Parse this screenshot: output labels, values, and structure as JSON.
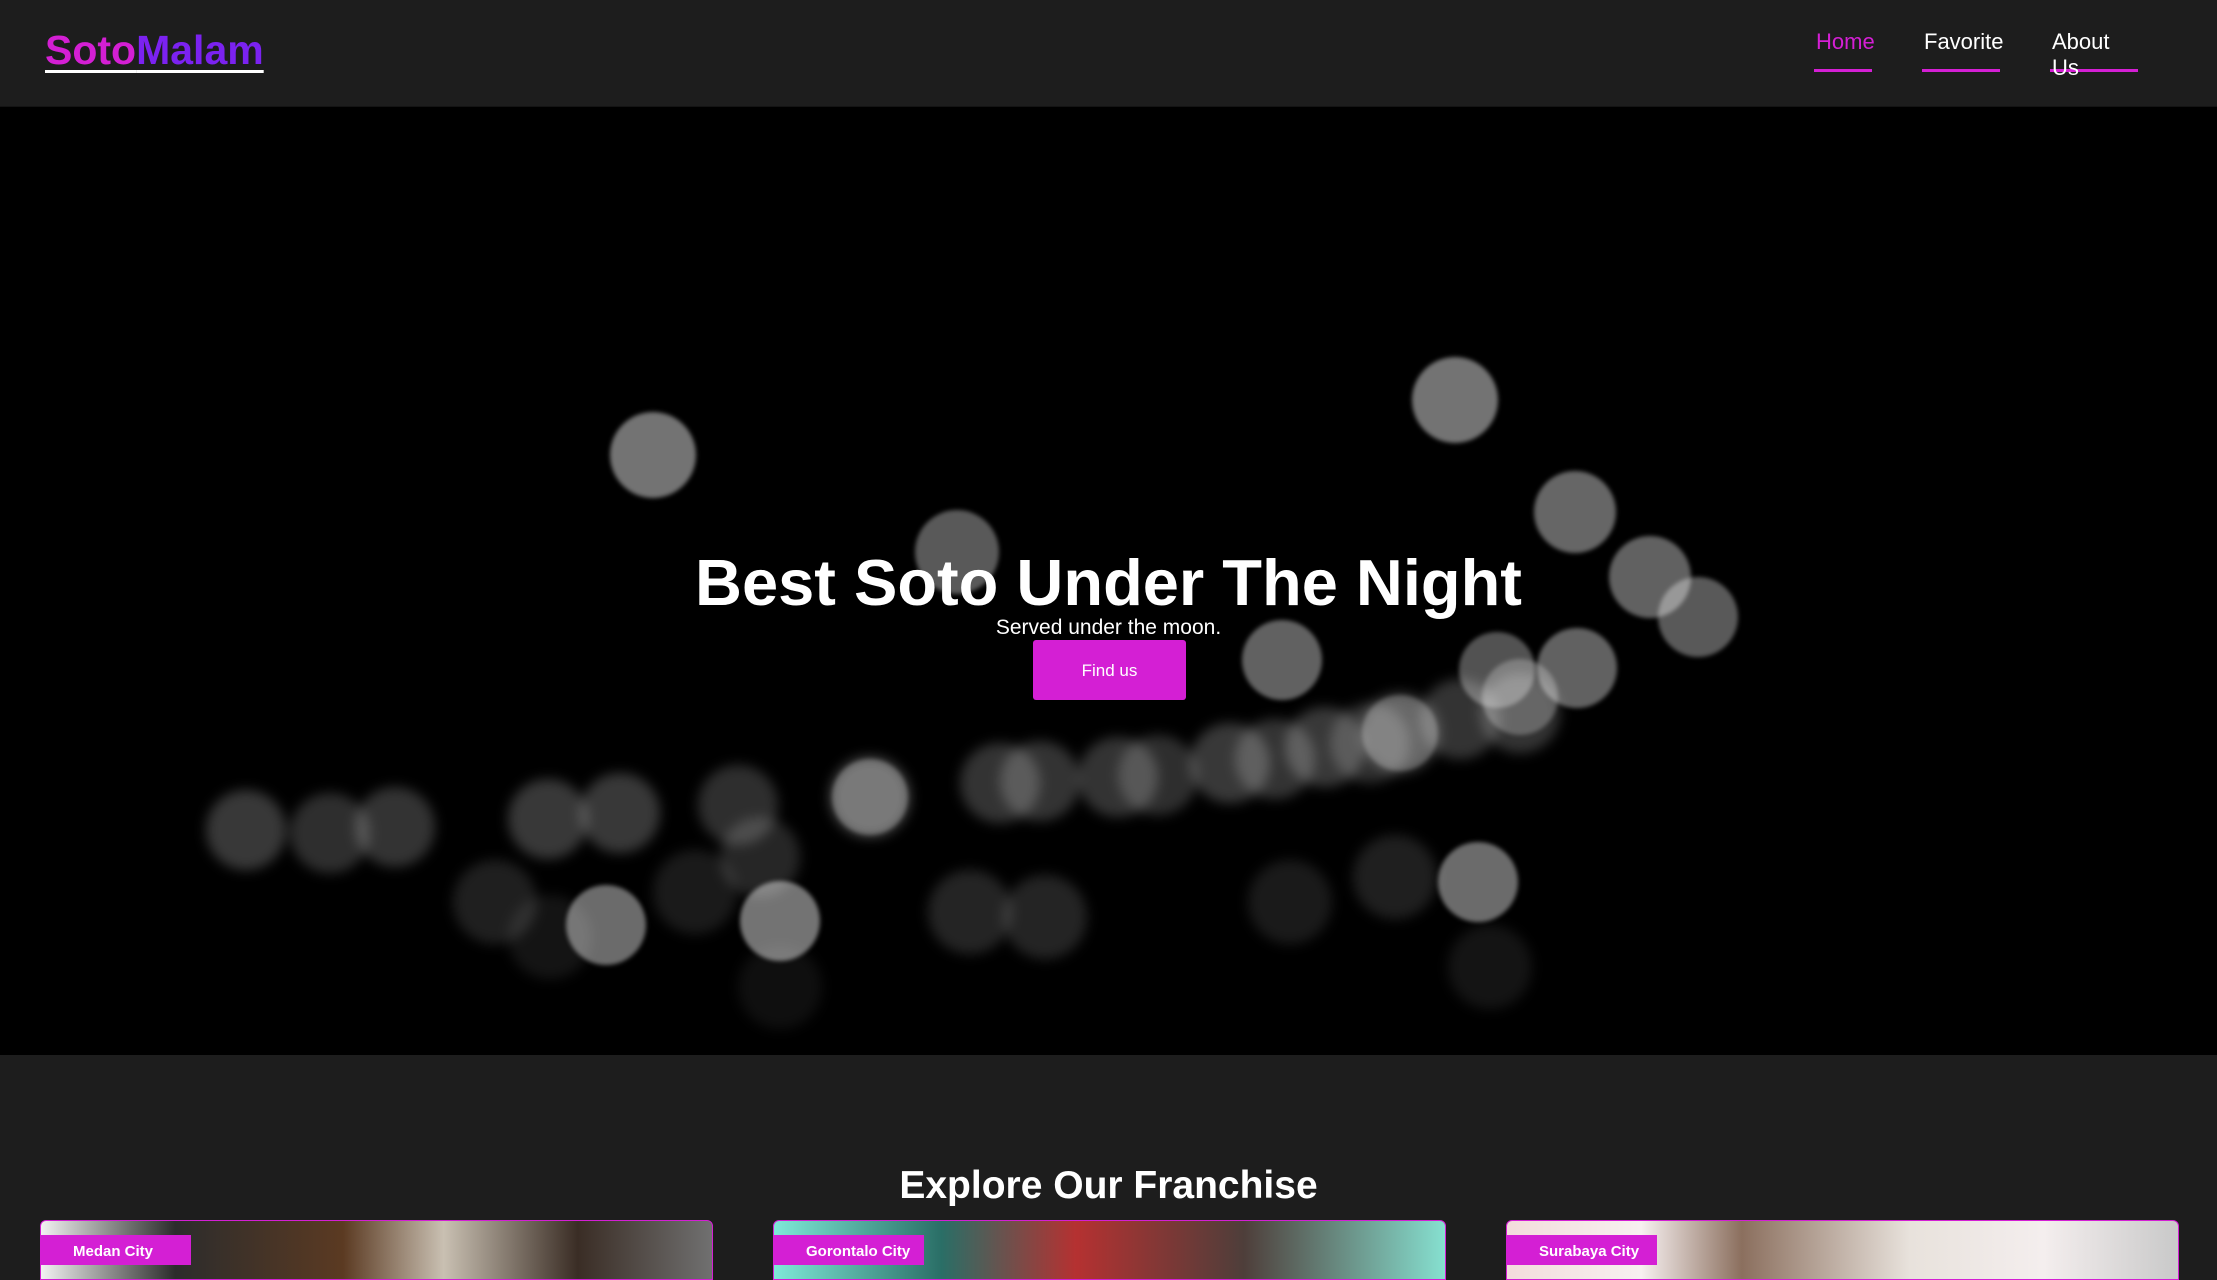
{
  "brand": {
    "part1": "Soto",
    "part2": "Malam"
  },
  "nav": {
    "items": [
      {
        "label": "Home",
        "active": true
      },
      {
        "label": "Favorite",
        "active": false
      },
      {
        "label": "About Us",
        "active": false
      }
    ]
  },
  "hero": {
    "title": "Best Soto Under The Night",
    "subtitle": "Served under the moon.",
    "button_label": "Find us"
  },
  "franchise": {
    "title": "Explore Our Franchise",
    "cards": [
      {
        "tag": "Medan City"
      },
      {
        "tag": "Gorontalo City"
      },
      {
        "tag": "Surabaya City"
      }
    ]
  },
  "colors": {
    "accent": "#d41fd4",
    "accent_secondary": "#7b22f0",
    "background": "#1d1d1d",
    "hero_background": "#000000"
  }
}
